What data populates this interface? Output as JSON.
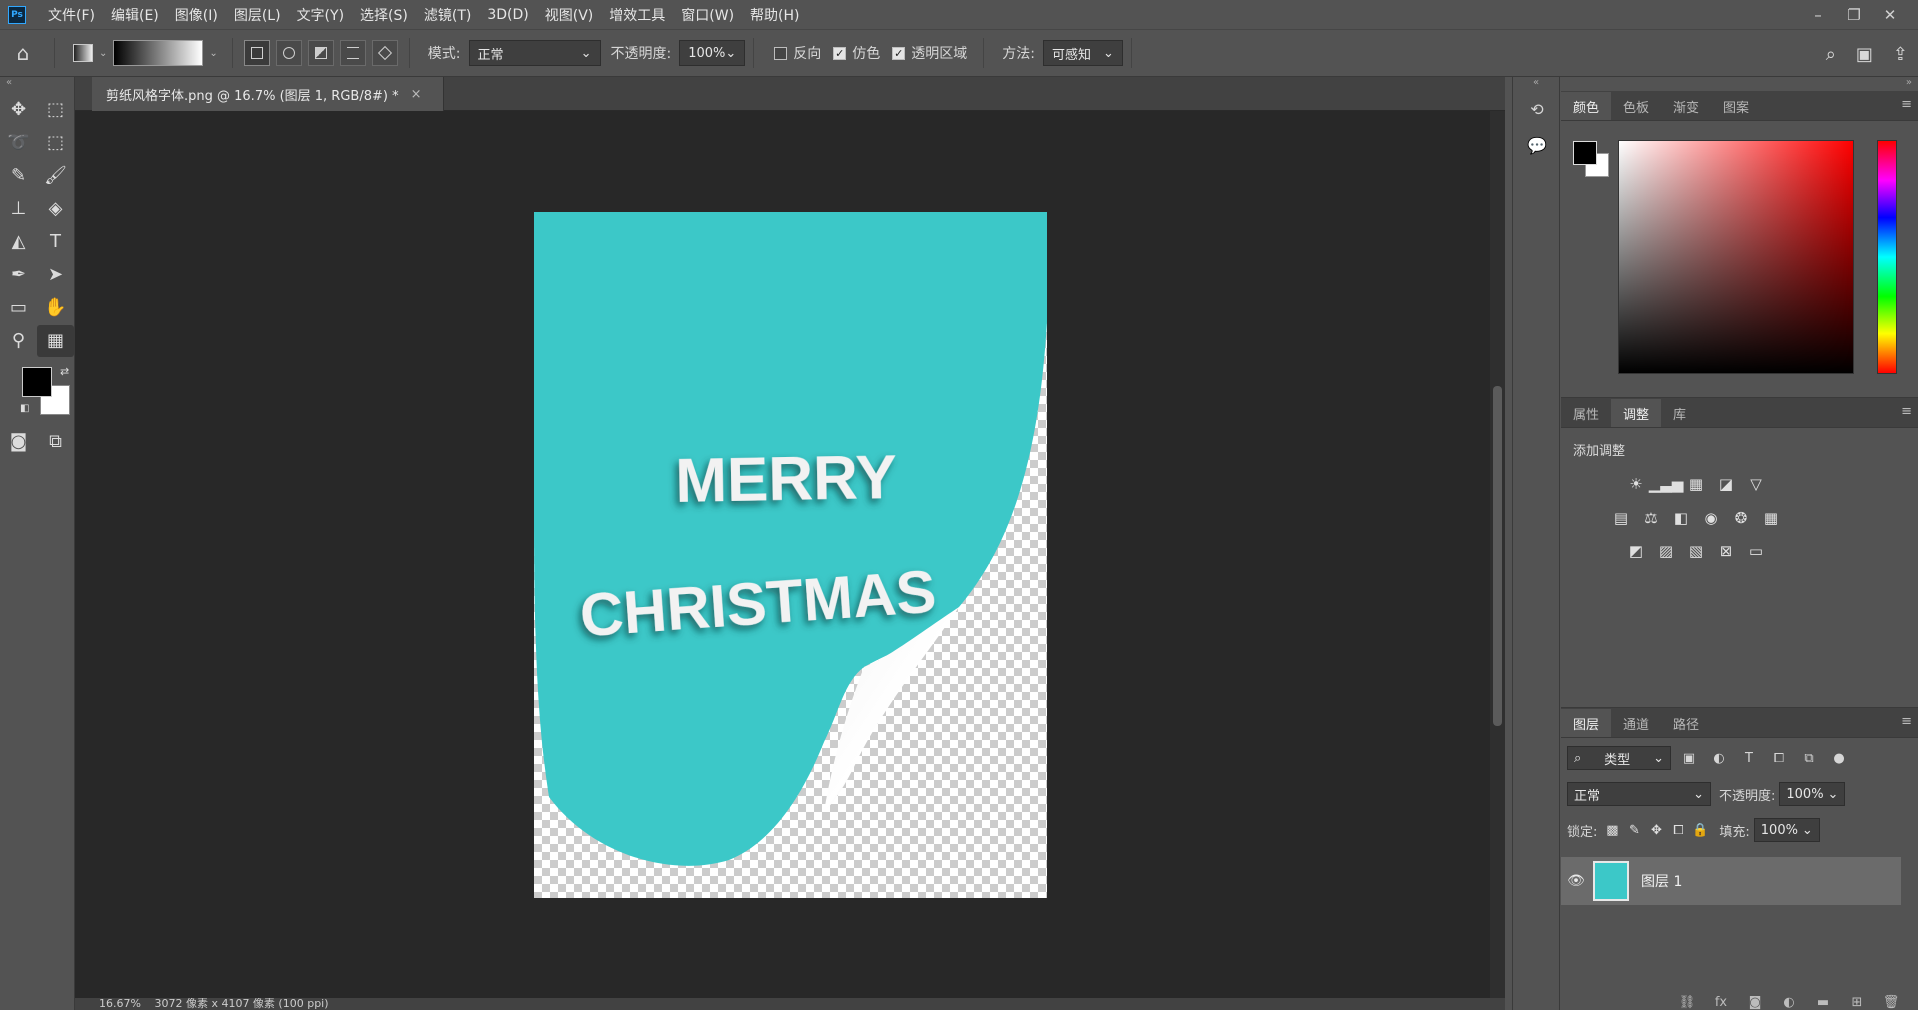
{
  "app": {
    "logo": "Ps",
    "menus": [
      "文件(F)",
      "编辑(E)",
      "图像(I)",
      "图层(L)",
      "文字(Y)",
      "选择(S)",
      "滤镜(T)",
      "3D(D)",
      "视图(V)",
      "增效工具",
      "窗口(W)",
      "帮助(H)"
    ],
    "window_controls": {
      "minimize": "–",
      "restore": "❐",
      "close": "✕"
    }
  },
  "options": {
    "mode_label": "模式:",
    "mode_value": "正常",
    "opacity_label": "不透明度:",
    "opacity_value": "100%",
    "reverse_label": "反向",
    "reverse_checked": false,
    "dither_label": "仿色",
    "dither_checked": true,
    "transparency_label": "透明区域",
    "transparency_checked": true,
    "method_label": "方法:",
    "method_value": "可感知"
  },
  "document": {
    "tab_title": "剪纸风格字体.png @ 16.7% (图层 1, RGB/8#) *",
    "canvas_text_line1": "MERRY",
    "canvas_text_line2": "CHRISTMAS",
    "paper_color": "#3cc8c8"
  },
  "status": {
    "zoom": "16.67%",
    "size": "3072 像素 x 4107 像素 (100 ppi)"
  },
  "color_panel": {
    "tabs": [
      "颜色",
      "色板",
      "渐变",
      "图案"
    ],
    "active_tab": 0
  },
  "adjust_panel": {
    "tabs": [
      "属性",
      "调整",
      "库"
    ],
    "active_tab": 1,
    "title": "添加调整"
  },
  "layers_panel": {
    "tabs": [
      "图层",
      "通道",
      "路径"
    ],
    "active_tab": 0,
    "filter_label": "类型",
    "blend_mode": "正常",
    "opacity_label": "不透明度:",
    "opacity_value": "100%",
    "lock_label": "锁定:",
    "fill_label": "填充:",
    "fill_value": "100%",
    "layer_name": "图层 1"
  }
}
